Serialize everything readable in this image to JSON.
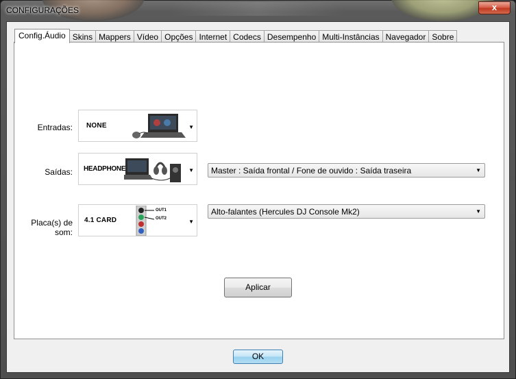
{
  "window": {
    "title": "CONFIGURAÇÕES",
    "close_glyph": "x"
  },
  "tabs": [
    {
      "label": "Config.Áudio",
      "active": true
    },
    {
      "label": "Skins"
    },
    {
      "label": "Mappers"
    },
    {
      "label": "Vídeo"
    },
    {
      "label": "Opções"
    },
    {
      "label": "Internet"
    },
    {
      "label": "Codecs"
    },
    {
      "label": "Desempenho"
    },
    {
      "label": "Multi-Instâncias"
    },
    {
      "label": "Navegador"
    },
    {
      "label": "Sobre"
    }
  ],
  "audio": {
    "inputs": {
      "label": "Entradas:",
      "value": "NONE",
      "icon": "laptop-turntable-icon"
    },
    "outputs": {
      "label": "Saídas:",
      "value": "HEADPHONES",
      "icon": "laptop-headphones-speaker-icon",
      "routing": "Master : Saída frontal / Fone de ouvido : Saída traseira"
    },
    "soundcard": {
      "label": "Placa(s) de som:",
      "value": "4.1 CARD",
      "icon": "soundcard-jacks-icon",
      "out1": "OUT1",
      "out2": "OUT2",
      "device": "Alto-falantes (Hercules DJ Console Mk2)"
    },
    "apply_label": "Aplicar"
  },
  "footer": {
    "ok_label": "OK"
  },
  "icons": {
    "dropdown": "dropdown-arrow-icon"
  }
}
